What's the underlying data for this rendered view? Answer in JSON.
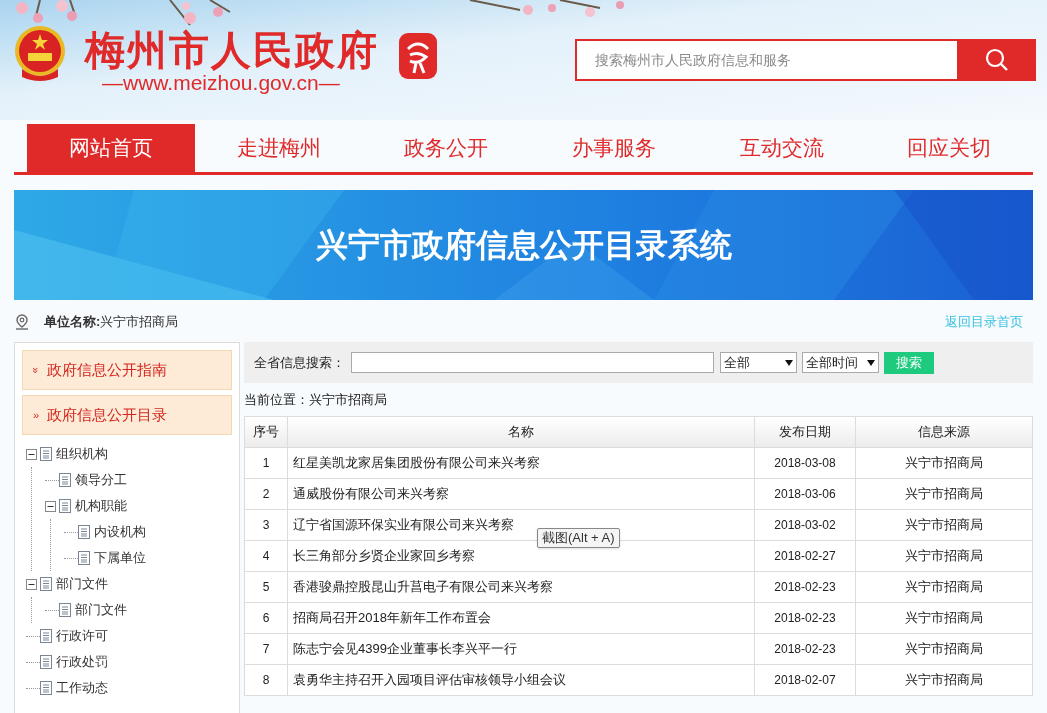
{
  "header": {
    "site_title": "梅州市人民政府",
    "site_url": "—www.meizhou.gov.cn—",
    "search": {
      "placeholder": "搜索梅州市人民政府信息和服务"
    }
  },
  "nav": [
    {
      "label": "网站首页",
      "selected": true
    },
    {
      "label": "走进梅州",
      "selected": false
    },
    {
      "label": "政务公开",
      "selected": false
    },
    {
      "label": "办事服务",
      "selected": false
    },
    {
      "label": "互动交流",
      "selected": false
    },
    {
      "label": "回应关切",
      "selected": false
    }
  ],
  "banner": {
    "title": "兴宁市政府信息公开目录系统"
  },
  "unit": {
    "label": "单位名称:",
    "value": "兴宁市招商局",
    "back_link": "返回目录首页"
  },
  "sidebar": {
    "sections": [
      {
        "label": "政府信息公开指南",
        "marker": "»",
        "expanded": true
      },
      {
        "label": "政府信息公开目录",
        "marker": "»",
        "expanded": false
      }
    ],
    "tree": [
      {
        "label": "组织机构",
        "expanded": true,
        "children": [
          {
            "label": "领导分工"
          },
          {
            "label": "机构职能",
            "expanded": true,
            "children": [
              {
                "label": "内设机构"
              },
              {
                "label": "下属单位"
              }
            ]
          }
        ]
      },
      {
        "label": "部门文件",
        "expanded": true,
        "children": [
          {
            "label": "部门文件"
          }
        ]
      },
      {
        "label": "行政许可"
      },
      {
        "label": "行政处罚"
      },
      {
        "label": "工作动态"
      }
    ]
  },
  "search_bar": {
    "label": "全省信息搜索：",
    "scope": "全部",
    "time": "全部时间",
    "button": "搜索"
  },
  "breadcrumb": "当前位置：兴宁市招商局",
  "table": {
    "columns": [
      "序号",
      "名称",
      "发布日期",
      "信息来源"
    ],
    "rows": [
      [
        "1",
        "红星美凯龙家居集团股份有限公司来兴考察",
        "2018-03-08",
        "兴宁市招商局"
      ],
      [
        "2",
        "通威股份有限公司来兴考察",
        "2018-03-06",
        "兴宁市招商局"
      ],
      [
        "3",
        "辽宁省国源环保实业有限公司来兴考察",
        "2018-03-02",
        "兴宁市招商局"
      ],
      [
        "4",
        "长三角部分乡贤企业家回乡考察",
        "2018-02-27",
        "兴宁市招商局"
      ],
      [
        "5",
        "香港骏鼎控股昆山升菖电子有限公司来兴考察",
        "2018-02-23",
        "兴宁市招商局"
      ],
      [
        "6",
        "招商局召开2018年新年工作布置会",
        "2018-02-23",
        "兴宁市招商局"
      ],
      [
        "7",
        "陈志宁会见4399企业董事长李兴平一行",
        "2018-02-23",
        "兴宁市招商局"
      ],
      [
        "8",
        "袁勇华主持召开入园项目评估审核领导小组会议",
        "2018-02-07",
        "兴宁市招商局"
      ]
    ]
  },
  "tooltip": "截图(Alt + A)"
}
